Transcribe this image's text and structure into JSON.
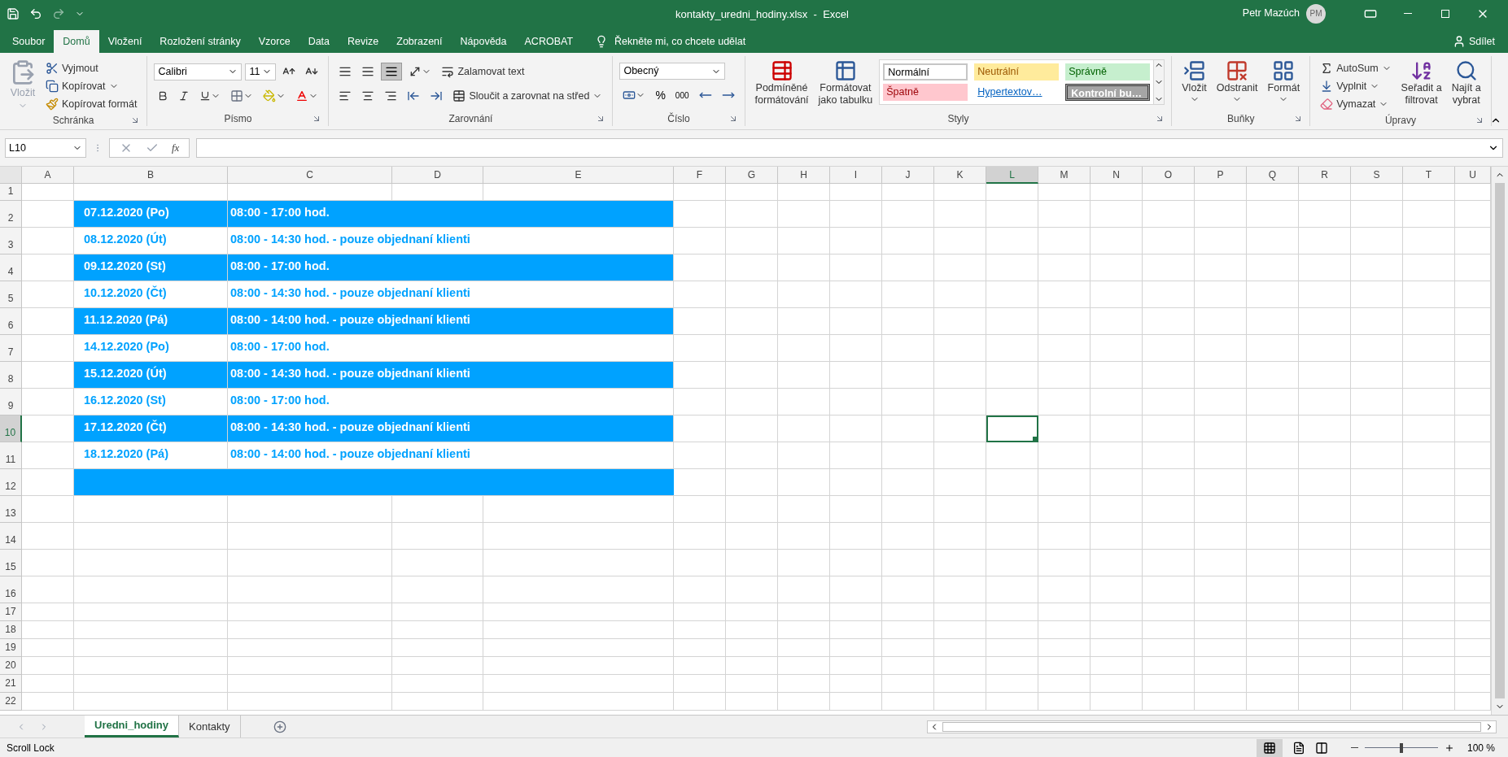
{
  "window": {
    "title": "kontakty_uredni_hodiny.xlsx  -  Excel",
    "user": "Petr Mazúch",
    "avatar_initials": "PM"
  },
  "ribbon_tabs": [
    {
      "label": "Soubor",
      "selected": false
    },
    {
      "label": "Domů",
      "selected": true
    },
    {
      "label": "Vložení",
      "selected": false
    },
    {
      "label": "Rozložení stránky",
      "selected": false
    },
    {
      "label": "Vzorce",
      "selected": false
    },
    {
      "label": "Data",
      "selected": false
    },
    {
      "label": "Revize",
      "selected": false
    },
    {
      "label": "Zobrazení",
      "selected": false
    },
    {
      "label": "Nápověda",
      "selected": false
    },
    {
      "label": "ACROBAT",
      "selected": false
    }
  ],
  "tell_me": {
    "placeholder": "Řekněte mi, co chcete udělat"
  },
  "share": "Sdílet",
  "ribbon": {
    "clipboard": {
      "title": "Schránka",
      "paste": {
        "label": "Vložit",
        "disabled": true
      },
      "cut": "Vyjmout",
      "copy": "Kopírovat",
      "format_painter": "Kopírovat formát"
    },
    "font": {
      "title": "Písmo",
      "font_name": "Calibri",
      "font_size": "11"
    },
    "alignment": {
      "title": "Zarovnání",
      "wrap_text": "Zalamovat text",
      "merge_center": "Sloučit a zarovnat na střed"
    },
    "number": {
      "title": "Číslo",
      "format": "Obecný",
      "percent": "%",
      "thousands": "000"
    },
    "styles": {
      "title": "Styly",
      "conditional_formatting": [
        "Podmíněné",
        "formátování"
      ],
      "format_as_table": [
        "Formátovat",
        "jako tabulku"
      ],
      "cell_styles": [
        {
          "label": "Normální",
          "kind": "normal"
        },
        {
          "label": "Neutrální",
          "kind": "neutral"
        },
        {
          "label": "Správně",
          "kind": "good"
        },
        {
          "label": "Špatně",
          "kind": "bad"
        },
        {
          "label": "Hypertextov…",
          "kind": "hyperlink"
        },
        {
          "label": "Kontrolní bu…",
          "kind": "check"
        }
      ]
    },
    "cells": {
      "title": "Buňky",
      "insert": "Vložit",
      "delete": "Odstranit",
      "format": "Formát"
    },
    "editing": {
      "title": "Úpravy",
      "autosum": "AutoSum",
      "fill": "Vyplnit",
      "clear": "Vymazat",
      "sort_filter": [
        "Seřadit a",
        "filtrovat"
      ],
      "find_select": [
        "Najít a",
        "vybrat"
      ]
    }
  },
  "formula_bar": {
    "name_box": "L10",
    "function_label": "fx"
  },
  "columns": [
    {
      "label": "A",
      "selected": false
    },
    {
      "label": "B",
      "selected": false
    },
    {
      "label": "C",
      "selected": false
    },
    {
      "label": "D",
      "selected": false
    },
    {
      "label": "E",
      "selected": false
    },
    {
      "label": "F",
      "selected": false
    },
    {
      "label": "G",
      "selected": false
    },
    {
      "label": "H",
      "selected": false
    },
    {
      "label": "I",
      "selected": false
    },
    {
      "label": "J",
      "selected": false
    },
    {
      "label": "K",
      "selected": false
    },
    {
      "label": "L",
      "selected": true
    },
    {
      "label": "M",
      "selected": false
    },
    {
      "label": "N",
      "selected": false
    },
    {
      "label": "O",
      "selected": false
    },
    {
      "label": "P",
      "selected": false
    },
    {
      "label": "Q",
      "selected": false
    },
    {
      "label": "R",
      "selected": false
    },
    {
      "label": "S",
      "selected": false
    },
    {
      "label": "T",
      "selected": false
    },
    {
      "label": "U",
      "selected": false
    }
  ],
  "rows": [
    {
      "number": "1",
      "selected": false
    },
    {
      "number": "2",
      "selected": false,
      "highlighted": true,
      "date": "07.12.2020 (Po)",
      "hours": "08:00 - 17:00 hod."
    },
    {
      "number": "3",
      "selected": false,
      "highlighted": false,
      "date": "08.12.2020 (Út)",
      "hours": "08:00 - 14:30 hod. - pouze objednaní klienti"
    },
    {
      "number": "4",
      "selected": false,
      "highlighted": true,
      "date": "09.12.2020 (St)",
      "hours": "08:00 - 17:00 hod."
    },
    {
      "number": "5",
      "selected": false,
      "highlighted": false,
      "date": "10.12.2020 (Čt)",
      "hours": "08:00 - 14:30 hod. - pouze objednaní klienti"
    },
    {
      "number": "6",
      "selected": false,
      "highlighted": true,
      "date": "11.12.2020 (Pá)",
      "hours": "08:00 - 14:00 hod. - pouze objednaní klienti"
    },
    {
      "number": "7",
      "selected": false,
      "highlighted": false,
      "date": "14.12.2020 (Po)",
      "hours": "08:00 - 17:00 hod."
    },
    {
      "number": "8",
      "selected": false,
      "highlighted": true,
      "date": "15.12.2020 (Út)",
      "hours": "08:00 - 14:30 hod. - pouze objednaní klienti"
    },
    {
      "number": "9",
      "selected": false,
      "highlighted": false,
      "date": "16.12.2020 (St)",
      "hours": "08:00 - 17:00 hod."
    },
    {
      "number": "10",
      "selected": true,
      "highlighted": true,
      "date": "17.12.2020 (Čt)",
      "hours": "08:00 - 14:30 hod. - pouze objednaní klienti"
    },
    {
      "number": "11",
      "selected": false,
      "highlighted": false,
      "date": "18.12.2020 (Pá)",
      "hours": "08:00 - 14:00 hod. - pouze objednaní klienti"
    },
    {
      "number": "12",
      "selected": false,
      "highlighted": true
    },
    {
      "number": "13",
      "selected": false
    },
    {
      "number": "14",
      "selected": false
    },
    {
      "number": "15",
      "selected": false
    },
    {
      "number": "16",
      "selected": false
    },
    {
      "number": "17",
      "selected": false
    },
    {
      "number": "18",
      "selected": false
    },
    {
      "number": "19",
      "selected": false
    },
    {
      "number": "20",
      "selected": false
    },
    {
      "number": "21",
      "selected": false
    },
    {
      "number": "22",
      "selected": false
    }
  ],
  "sheet_tabs": [
    {
      "label": "Uredni_hodiny",
      "selected": true
    },
    {
      "label": "Kontakty",
      "selected": false
    }
  ],
  "status_bar": {
    "mode": "Scroll Lock",
    "zoom": "100 %",
    "zoom_slider": {
      "level": 0.5
    }
  }
}
